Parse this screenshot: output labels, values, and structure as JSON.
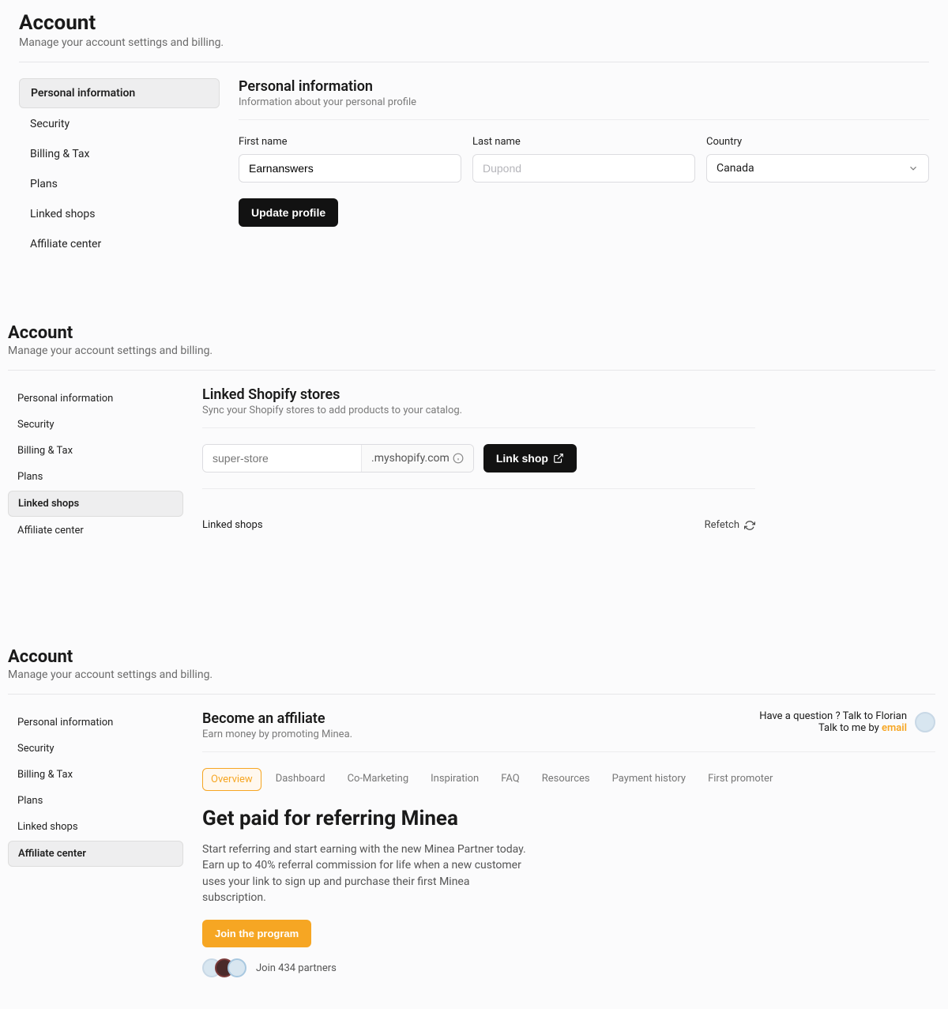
{
  "panel1": {
    "title": "Account",
    "subtitle": "Manage your account settings and billing.",
    "tabs": [
      "Personal information",
      "Security",
      "Billing & Tax",
      "Plans",
      "Linked shops",
      "Affiliate center"
    ],
    "section": {
      "title": "Personal information",
      "subtitle": "Information about your personal profile",
      "first_label": "First name",
      "first_value": "Earnanswers",
      "last_label": "Last name",
      "last_placeholder": "Dupond",
      "country_label": "Country",
      "country_value": "Canada",
      "button": "Update profile"
    }
  },
  "panel2": {
    "title": "Account",
    "subtitle": "Manage your account settings and billing.",
    "tabs": [
      "Personal information",
      "Security",
      "Billing & Tax",
      "Plans",
      "Linked shops",
      "Affiliate center"
    ],
    "section": {
      "title": "Linked Shopify stores",
      "subtitle": "Sync your Shopify stores to add products to your catalog.",
      "placeholder": "super-store",
      "suffix": ".myshopify.com",
      "button": "Link shop",
      "linked_label": "Linked shops",
      "refetch": "Refetch"
    }
  },
  "panel3": {
    "title": "Account",
    "subtitle": "Manage your account settings and billing.",
    "tabs": [
      "Personal information",
      "Security",
      "Billing & Tax",
      "Plans",
      "Linked shops",
      "Affiliate center"
    ],
    "section": {
      "title": "Become an affiliate",
      "subtitle": "Earn money by promoting Minea.",
      "question": "Have a question ? Talk to Florian",
      "talk_prefix": "Talk to me by ",
      "email": "email",
      "subtabs": [
        "Overview",
        "Dashboard",
        "Co-Marketing",
        "Inspiration",
        "FAQ",
        "Resources",
        "Payment history",
        "First promoter"
      ],
      "heading": "Get paid for referring Minea",
      "body": "Start referring and start earning with the new Minea Partner today. Earn up to 40% referral commission for life when a new customer uses your link to sign up and purchase their first Minea subscription.",
      "button": "Join the program",
      "partners": "Join 434 partners"
    }
  }
}
